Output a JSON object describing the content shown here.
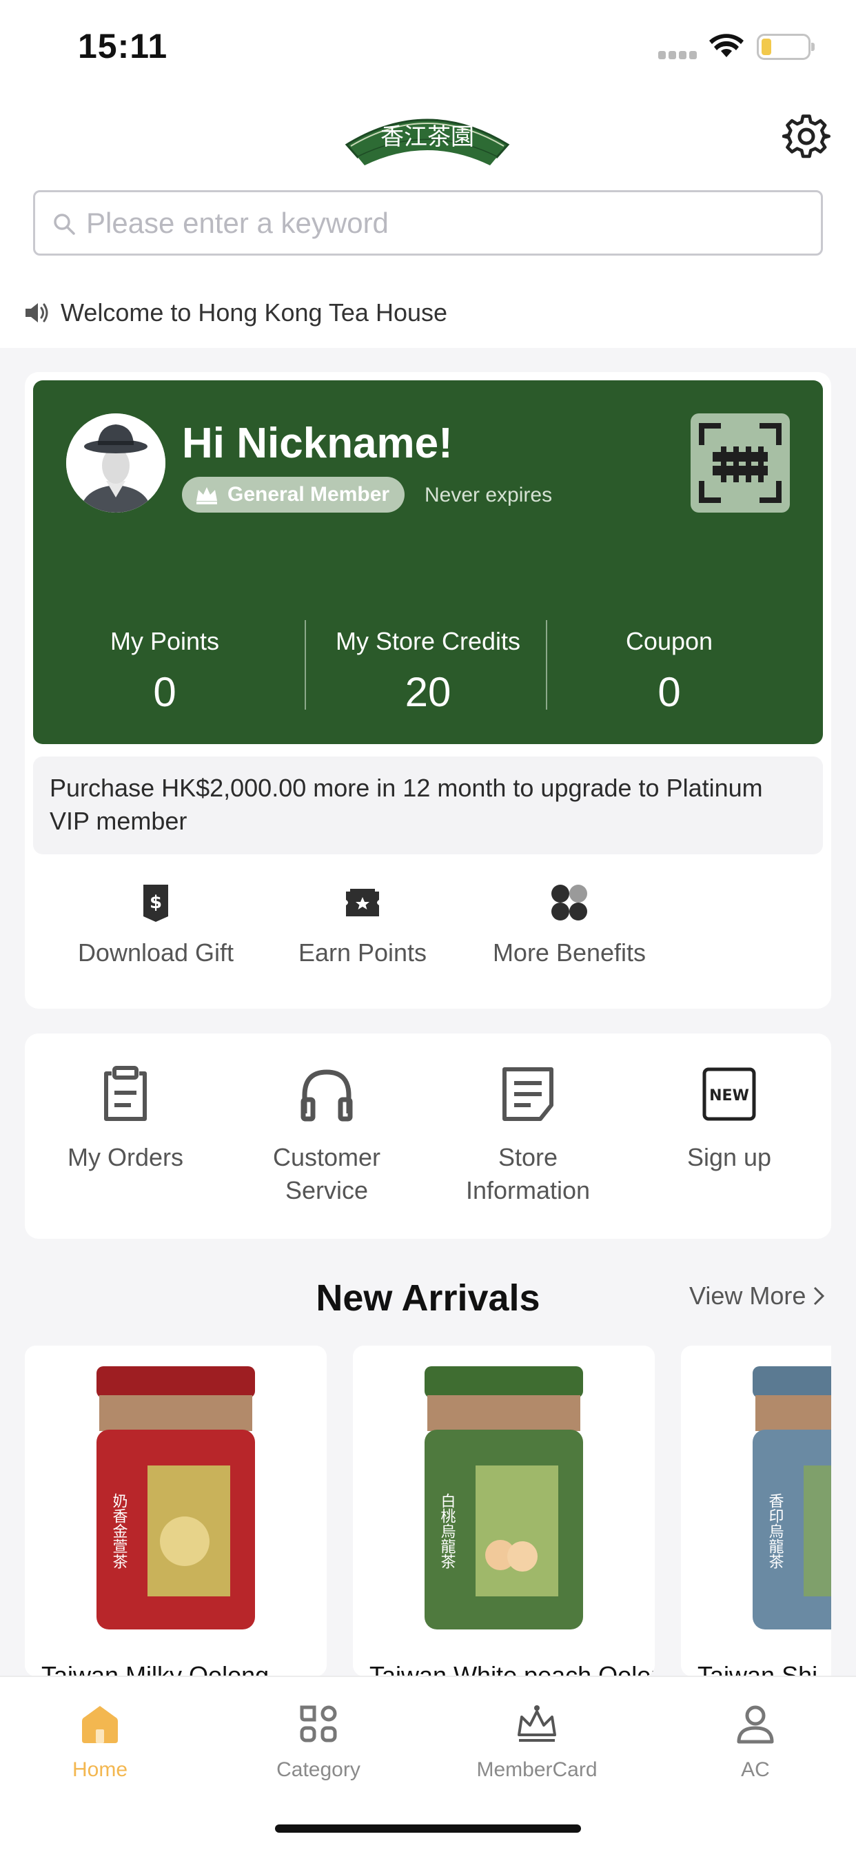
{
  "status_bar": {
    "time": "15:11"
  },
  "header": {
    "logo_text": "香江茶園",
    "search_placeholder": "Please enter a keyword"
  },
  "notice": {
    "text": "Welcome to Hong Kong Tea House"
  },
  "member_card": {
    "greeting": "Hi Nickname!",
    "membership_level": "General Member",
    "expiry": "Never expires",
    "stats": [
      {
        "label": "My Points",
        "value": "0"
      },
      {
        "label": "My Store Credits",
        "value": "20"
      },
      {
        "label": "Coupon",
        "value": "0"
      }
    ],
    "upgrade_text": "Purchase HK$2,000.00 more in 12 month to upgrade to Platinum VIP member",
    "benefits": [
      {
        "label": "Download Gift",
        "icon": "gift-voucher-icon"
      },
      {
        "label": "Earn Points",
        "icon": "ticket-star-icon"
      },
      {
        "label": "More Benefits",
        "icon": "grid-four-icon"
      }
    ]
  },
  "shortcuts": [
    {
      "label": "My Orders",
      "icon": "clipboard-icon"
    },
    {
      "label": "Customer Service",
      "icon": "headphones-icon"
    },
    {
      "label": "Store Information",
      "icon": "document-icon"
    },
    {
      "label": "Sign up",
      "icon": "new-badge-icon"
    }
  ],
  "new_arrivals": {
    "title": "New Arrivals",
    "view_more": "View More",
    "products": [
      {
        "name": "Taiwan Milky Oolong",
        "jar_color": "#b8262a",
        "jar_label": "奶香金萱茶"
      },
      {
        "name": "Taiwan White peach Oolong",
        "jar_color": "#4f7a3e",
        "jar_label": "白桃烏龍茶"
      },
      {
        "name": "Taiwan Shi",
        "jar_color": "#6a8aa3",
        "jar_label": "香印烏龍茶"
      }
    ]
  },
  "tabbar": {
    "tabs": [
      {
        "label": "Home",
        "icon": "home-icon",
        "active": true
      },
      {
        "label": "Category",
        "icon": "category-grid-icon",
        "active": false
      },
      {
        "label": "MemberCard",
        "icon": "crown-icon",
        "active": false
      },
      {
        "label": "AC",
        "icon": "person-icon",
        "active": false
      }
    ]
  },
  "colors": {
    "brand_green": "#2b5a2a",
    "active_tab": "#f3b750",
    "page_bg": "#f5f5f7"
  }
}
